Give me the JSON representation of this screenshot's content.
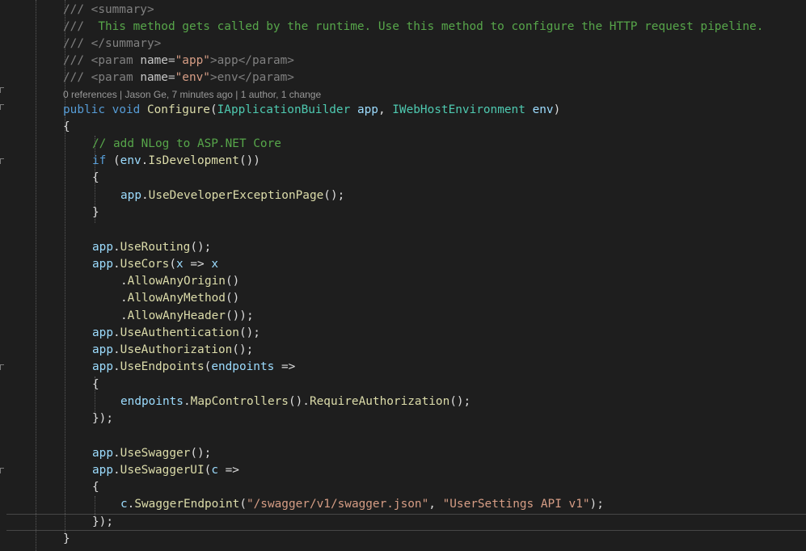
{
  "editor": {
    "codelens": {
      "references": "0 references",
      "author_info": "Jason Ge, 7 minutes ago",
      "changes": "1 author, 1 change",
      "separator": " | "
    },
    "tokens": {
      "doc_prefix": "/// ",
      "doc_summary_text": " This method gets called by the runtime. Use this method to configure the HTTP request pipeline.",
      "summary_open": "<summary>",
      "summary_close": "</summary>",
      "param_open": "<param ",
      "param_attr": "name=",
      "param_app_value": "\"app\"",
      "param_app_text": ">app</param>",
      "param_env_value": "\"env\"",
      "param_env_text": ">env</param>",
      "kw_public": "public",
      "kw_void": "void",
      "kw_if": "if",
      "method_name": "Configure",
      "type_builder": "IApplicationBuilder",
      "type_env": "IWebHostEnvironment",
      "var_app": "app",
      "var_env": "env",
      "var_x": "x",
      "var_endpoints": "endpoints",
      "var_c": "c",
      "comment_nlog": "// add NLog to ASP.NET Core",
      "fn_is_development": "IsDevelopment",
      "fn_use_developer_exception_page": "UseDeveloperExceptionPage",
      "fn_use_routing": "UseRouting",
      "fn_use_cors": "UseCors",
      "fn_allow_any_origin": "AllowAnyOrigin",
      "fn_allow_any_method": "AllowAnyMethod",
      "fn_allow_any_header": "AllowAnyHeader",
      "fn_use_authentication": "UseAuthentication",
      "fn_use_authorization": "UseAuthorization",
      "fn_use_endpoints": "UseEndpoints",
      "fn_map_controllers": "MapControllers",
      "fn_require_authorization": "RequireAuthorization",
      "fn_use_swagger": "UseSwagger",
      "fn_use_swagger_ui": "UseSwaggerUI",
      "fn_swagger_endpoint": "SwaggerEndpoint",
      "str_swagger_path": "\"/swagger/v1/swagger.json\"",
      "str_api_name": "\"UserSettings API v1\""
    }
  }
}
